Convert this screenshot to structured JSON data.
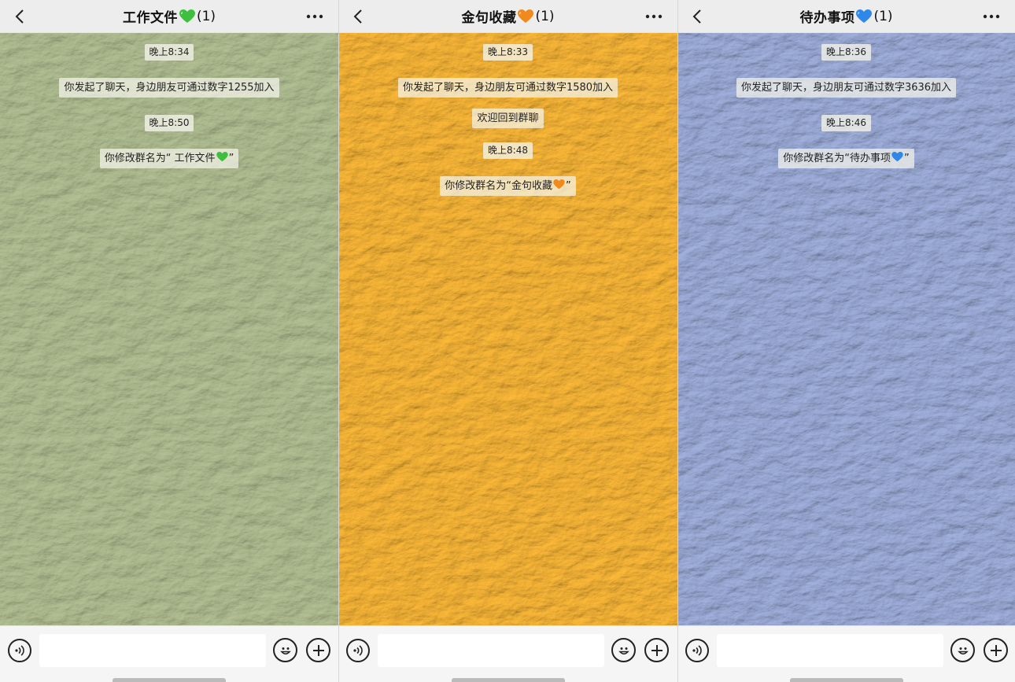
{
  "colors": {
    "green": "#a9b886",
    "orange": "#f7a823",
    "blue": "#8c9fd0",
    "heart_green": "#3fbf3f",
    "heart_orange": "#f08a1c",
    "heart_blue": "#2f87e8"
  },
  "panels": [
    {
      "title": "工作文件",
      "count": "(1)",
      "heart": "green-heart-icon",
      "messages": [
        {
          "type": "time",
          "text": "晚上8:34"
        },
        {
          "type": "system",
          "text": "你发起了聊天，身边朋友可通过数字1255加入"
        },
        {
          "type": "time",
          "text": "晚上8:50"
        },
        {
          "type": "rename",
          "prefix": "你修改群名为“ 工作文件",
          "suffix": "”"
        }
      ]
    },
    {
      "title": "金句收藏",
      "count": "(1)",
      "heart": "orange-heart-icon",
      "messages": [
        {
          "type": "time",
          "text": "晚上8:33"
        },
        {
          "type": "system",
          "text": "你发起了聊天，身边朋友可通过数字1580加入"
        },
        {
          "type": "system",
          "text": "欢迎回到群聊"
        },
        {
          "type": "time",
          "text": "晚上8:48"
        },
        {
          "type": "rename",
          "prefix": "你修改群名为“金句收藏",
          "suffix": "”"
        }
      ]
    },
    {
      "title": "待办事项",
      "count": "(1)",
      "heart": "blue-heart-icon",
      "messages": [
        {
          "type": "time",
          "text": "晚上8:36"
        },
        {
          "type": "system",
          "text": "你发起了聊天，身边朋友可通过数字3636加入"
        },
        {
          "type": "time",
          "text": "晚上8:46"
        },
        {
          "type": "rename",
          "prefix": "你修改群名为“待办事项",
          "suffix": "”"
        }
      ]
    }
  ],
  "icons": {
    "back": "chevron-left-icon",
    "more": "more-dots-icon",
    "voice": "voice-icon",
    "emoji": "emoji-icon",
    "plus": "plus-icon"
  }
}
